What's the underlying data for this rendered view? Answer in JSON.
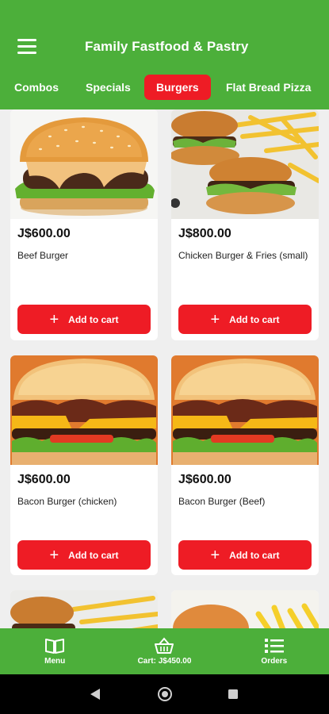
{
  "app": {
    "title": "Family Fastfood & Pastry",
    "accent": "#4caf3a",
    "cta_color": "#ee1c25"
  },
  "header": {
    "menu_icon": "hamburger-menu-icon"
  },
  "tabs": [
    {
      "label": "Combos",
      "active": false
    },
    {
      "label": "Specials",
      "active": false
    },
    {
      "label": "Burgers",
      "active": true
    },
    {
      "label": "Flat Bread Pizza",
      "active": false
    }
  ],
  "products": [
    {
      "price": "J$600.00",
      "name": "Beef Burger",
      "button": "Add to cart",
      "image": "beef-burger"
    },
    {
      "price": "J$800.00",
      "name": "Chicken Burger & Fries (small)",
      "button": "Add to cart",
      "image": "chicken-burger-fries"
    },
    {
      "price": "J$600.00",
      "name": "Bacon Burger (chicken)",
      "button": "Add to cart",
      "image": "bacon-burger"
    },
    {
      "price": "J$600.00",
      "name": "Bacon Burger (Beef)",
      "button": "Add to cart",
      "image": "bacon-burger"
    }
  ],
  "bottom_nav": {
    "menu": {
      "label": "Menu",
      "icon": "book-icon"
    },
    "cart": {
      "label": "Cart: J$450.00",
      "icon": "basket-icon"
    },
    "orders": {
      "label": "Orders",
      "icon": "list-icon"
    }
  },
  "system_nav": {
    "back": "back-icon",
    "home": "home-icon",
    "recents": "recents-icon"
  }
}
